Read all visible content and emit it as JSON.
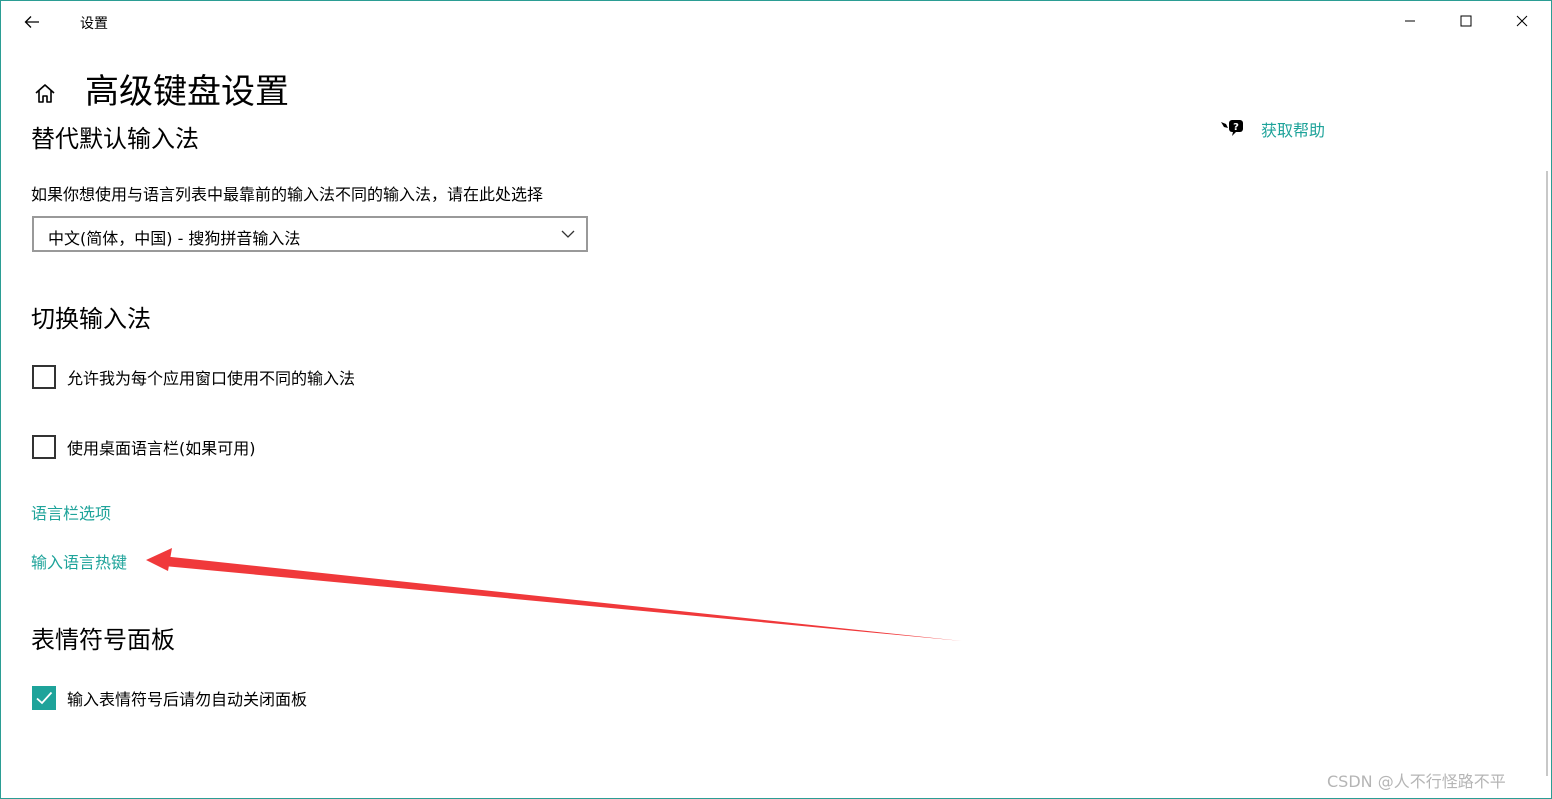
{
  "window": {
    "app_title": "设置",
    "accent_color": "#1ea39a",
    "icons": {
      "back": "back-arrow-icon",
      "minimize": "minimize-icon",
      "maximize": "maximize-icon",
      "close": "close-icon"
    }
  },
  "header": {
    "home_icon": "home-icon",
    "title": "高级键盘设置"
  },
  "help": {
    "icon": "help-chat-icon",
    "label": "获取帮助"
  },
  "override_section": {
    "heading": "替代默认输入法",
    "description": "如果你想使用与语言列表中最靠前的输入法不同的输入法，请在此处选择",
    "dropdown_value": "中文(简体，中国) - 搜狗拼音输入法"
  },
  "switch_section": {
    "heading": "切换输入法",
    "checkbox_per_app": {
      "label": "允许我为每个应用窗口使用不同的输入法",
      "checked": false
    },
    "checkbox_langbar": {
      "label": "使用桌面语言栏(如果可用)",
      "checked": false
    },
    "link_langbar_options": "语言栏选项",
    "link_input_hotkeys": "输入语言热键"
  },
  "emoji_section": {
    "heading": "表情符号面板",
    "checkbox_auto_close": {
      "label": "输入表情符号后请勿自动关闭面板",
      "checked": true
    }
  },
  "annotation": {
    "arrow_color": "#f0393b"
  },
  "watermark": "CSDN @人不行怪路不平"
}
